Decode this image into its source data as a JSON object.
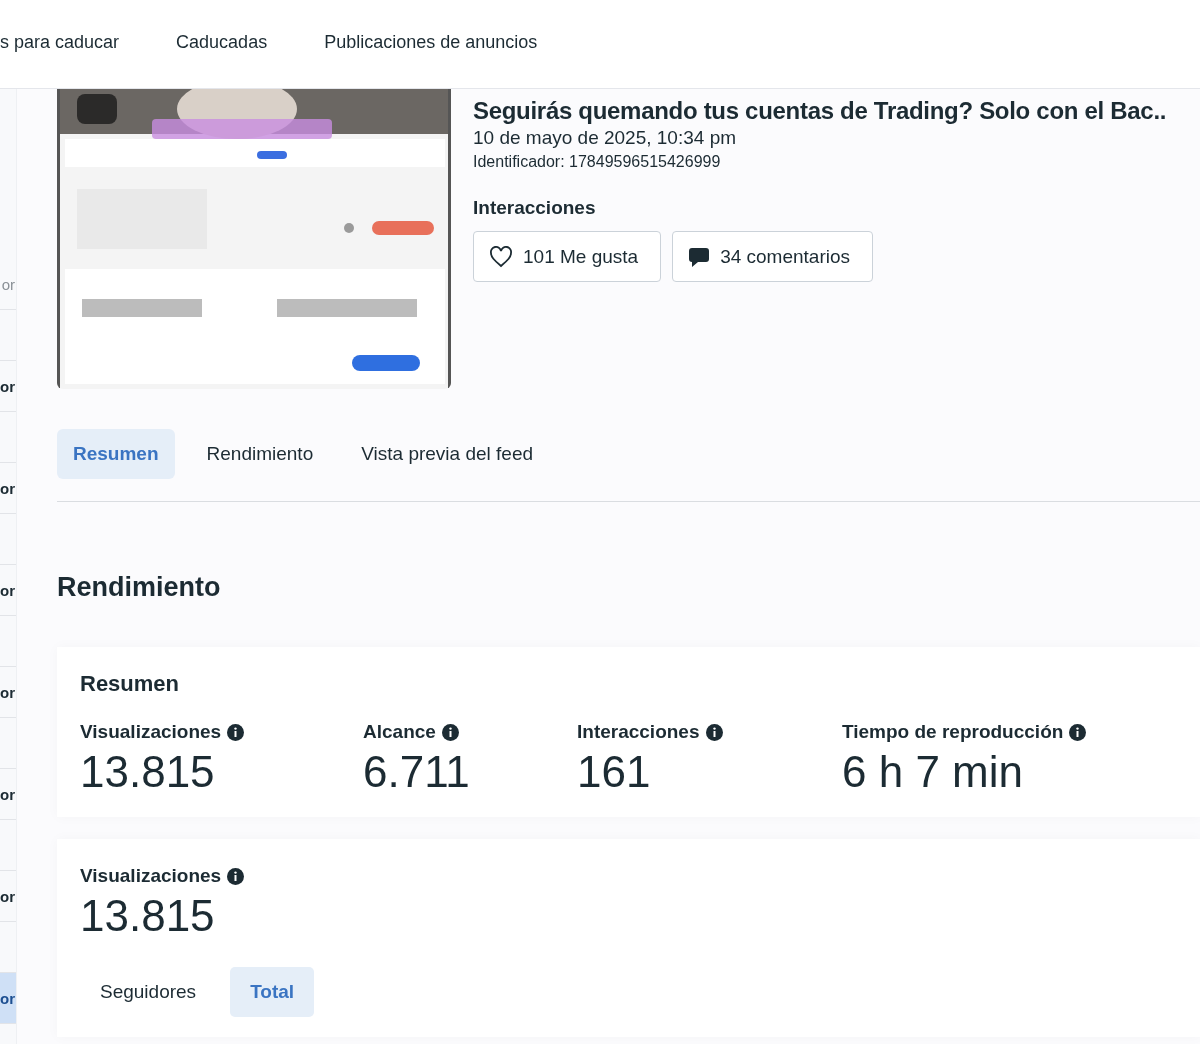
{
  "top_tabs": [
    {
      "label": "s para caducar",
      "selected": false
    },
    {
      "label": "Caducadas",
      "selected": false
    },
    {
      "label": "Publicaciones de anuncios",
      "selected": false
    }
  ],
  "side_rows": [
    {
      "label": "or",
      "selected": false,
      "dimmed": true
    },
    {
      "label": "or",
      "selected": false,
      "dimmed": false
    },
    {
      "label": "or",
      "selected": false,
      "dimmed": false
    },
    {
      "label": "or",
      "selected": false,
      "dimmed": false
    },
    {
      "label": "or",
      "selected": false,
      "dimmed": false
    },
    {
      "label": "or",
      "selected": false,
      "dimmed": false
    },
    {
      "label": "or",
      "selected": false,
      "dimmed": false
    },
    {
      "label": "or",
      "selected": true,
      "dimmed": false
    }
  ],
  "post": {
    "title": "Seguirás quemando tus cuentas de Trading? Solo con el Bac..",
    "date": "10 de mayo de 2025, 10:34 pm",
    "identifier": "Identificador: 17849596515426999",
    "interactions_heading": "Interacciones",
    "interactions": [
      {
        "kind": "likes",
        "label": "101 Me gusta"
      },
      {
        "kind": "comments",
        "label": "34 comentarios"
      }
    ]
  },
  "tabs": [
    {
      "label": "Resumen",
      "selected": true
    },
    {
      "label": "Rendimiento",
      "selected": false
    },
    {
      "label": "Vista previa del feed",
      "selected": false
    }
  ],
  "section_title": "Rendimiento",
  "summary": {
    "title": "Resumen",
    "metrics": [
      {
        "label": "Visualizaciones",
        "value": "13.815"
      },
      {
        "label": "Alcance",
        "value": "6.711"
      },
      {
        "label": "Interacciones",
        "value": "161"
      },
      {
        "label": "Tiempo de reproducción",
        "value": "6 h 7 min"
      }
    ]
  },
  "views": {
    "label": "Visualizaciones",
    "value": "13.815",
    "toggle": [
      {
        "label": "Seguidores",
        "selected": false
      },
      {
        "label": "Total",
        "selected": true
      }
    ]
  }
}
